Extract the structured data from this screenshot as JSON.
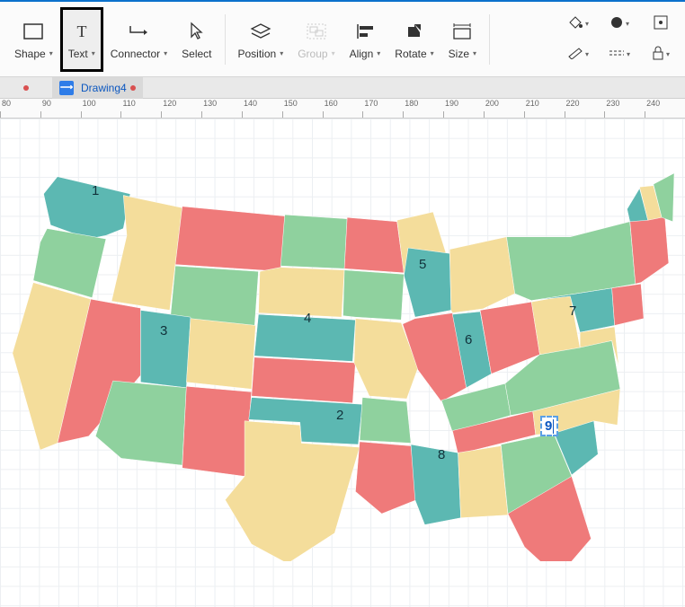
{
  "toolbar": {
    "shape": "Shape",
    "text": "Text",
    "connector": "Connector",
    "select": "Select",
    "position": "Position",
    "group": "Group",
    "align": "Align",
    "rotate": "Rotate",
    "size": "Size"
  },
  "tab": {
    "title": "Drawing4"
  },
  "ruler": {
    "ticks": [
      80,
      90,
      100,
      110,
      120,
      130,
      140,
      150,
      160,
      170,
      180,
      190,
      200,
      210,
      220,
      230,
      240
    ]
  },
  "map": {
    "labels": {
      "WA": "1",
      "OK": "2",
      "UT": "3",
      "NE": "4",
      "WI": "5",
      "IN": "6",
      "PA": "7",
      "MS": "8"
    },
    "editing": {
      "state": "SC",
      "value": "9"
    }
  },
  "palette": {
    "teal": "#5cb8b2",
    "red": "#ef7a7a",
    "yellow": "#f4dd9b",
    "green": "#8fd19e"
  }
}
